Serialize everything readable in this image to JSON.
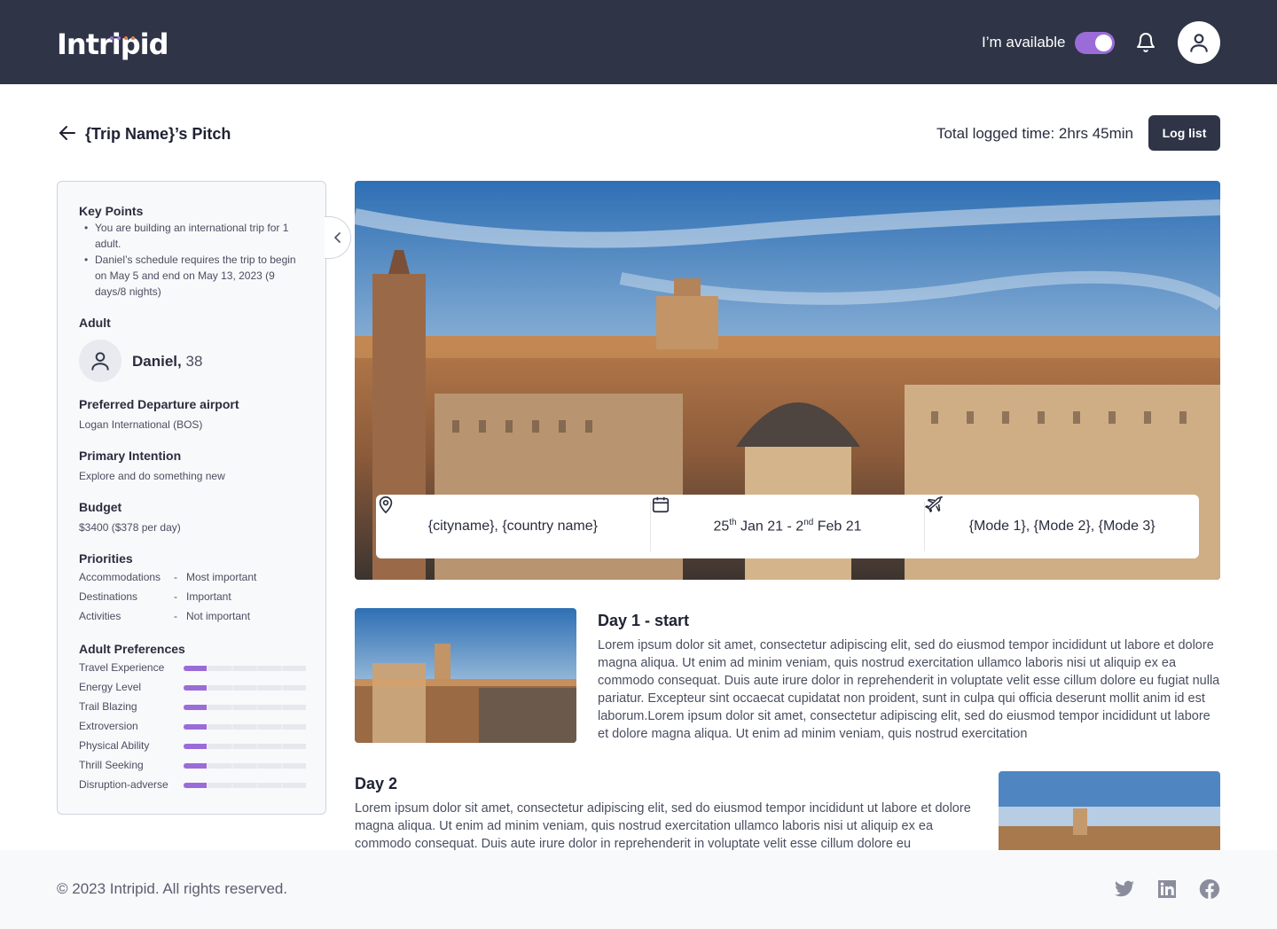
{
  "header": {
    "logo": "Intripid",
    "availability_label": "I’m available",
    "availability_on": true,
    "accent_color": "#9b6cd8",
    "icons": [
      "bell-icon",
      "user-icon"
    ]
  },
  "title_row": {
    "title": "{Trip Name}’s Pitch",
    "logged_time": "Total logged time: 2hrs 45min",
    "log_button": "Log list"
  },
  "sidebar": {
    "key_points_heading": "Key Points",
    "key_points": [
      "You are building an international trip for 1 adult.",
      "Daniel’s schedule requires the trip to begin on May 5 and end on May 13, 2023 (9 days/8 nights)"
    ],
    "adult_heading": "Adult",
    "adult_name": "Daniel,",
    "adult_age": "38",
    "airport_heading": "Preferred Departure airport",
    "airport_value": "Logan International (BOS)",
    "intention_heading": "Primary Intention",
    "intention_value": "Explore and do something new",
    "budget_heading": "Budget",
    "budget_value": "$3400 ($378 per day)",
    "priorities_heading": "Priorities",
    "priorities": [
      {
        "label": "Accommodations",
        "dash": "-",
        "value": "Most important"
      },
      {
        "label": "Destinations",
        "dash": "-",
        "value": "Important"
      },
      {
        "label": "Activities",
        "dash": "-",
        "value": "Not important"
      }
    ],
    "preferences_heading": "Adult Preferences",
    "preferences": [
      {
        "label": "Travel Experience",
        "level": 1,
        "max": 5
      },
      {
        "label": "Energy Level",
        "level": 1,
        "max": 5
      },
      {
        "label": "Trail Blazing",
        "level": 1,
        "max": 5
      },
      {
        "label": "Extroversion",
        "level": 1,
        "max": 5
      },
      {
        "label": "Physical Ability",
        "level": 1,
        "max": 5
      },
      {
        "label": "Thrill Seeking",
        "level": 1,
        "max": 5
      },
      {
        "label": "Disruption-adverse",
        "level": 1,
        "max": 5
      }
    ]
  },
  "hero": {
    "location": "{cityname}, {country name}",
    "date_start_day": "25",
    "date_start_sup": "th",
    "date_start_rest": " Jan 21 - 2",
    "date_end_sup": "nd",
    "date_end_rest": " Feb 21",
    "modes": "{Mode 1}, {Mode 2}, {Mode 3}"
  },
  "days": [
    {
      "title": "Day 1 - start",
      "text": "Lorem ipsum dolor sit amet, consectetur adipiscing elit, sed do eiusmod tempor incididunt ut labore et dolore magna aliqua. Ut enim ad minim veniam, quis nostrud exercitation ullamco laboris nisi ut aliquip ex ea commodo consequat. Duis aute irure dolor in reprehenderit in voluptate velit esse cillum dolore eu fugiat nulla pariatur. Excepteur sint occaecat cupidatat non proident, sunt in culpa qui officia deserunt mollit anim id est laborum.Lorem ipsum dolor sit amet, consectetur adipiscing elit, sed do eiusmod tempor incididunt ut labore et dolore magna aliqua. Ut enim ad minim veniam, quis nostrud exercitation"
    },
    {
      "title": "Day 2",
      "text": "Lorem ipsum dolor sit amet, consectetur adipiscing elit, sed do eiusmod tempor incididunt ut labore et dolore magna aliqua. Ut enim ad minim veniam, quis nostrud exercitation ullamco laboris nisi ut aliquip ex ea commodo consequat. Duis aute irure dolor in reprehenderit in voluptate velit esse cillum dolore eu"
    }
  ],
  "footer": {
    "copyright": "© 2023 Intripid. All rights reserved.",
    "social_icons": [
      "twitter-icon",
      "linkedin-icon",
      "facebook-icon"
    ]
  }
}
